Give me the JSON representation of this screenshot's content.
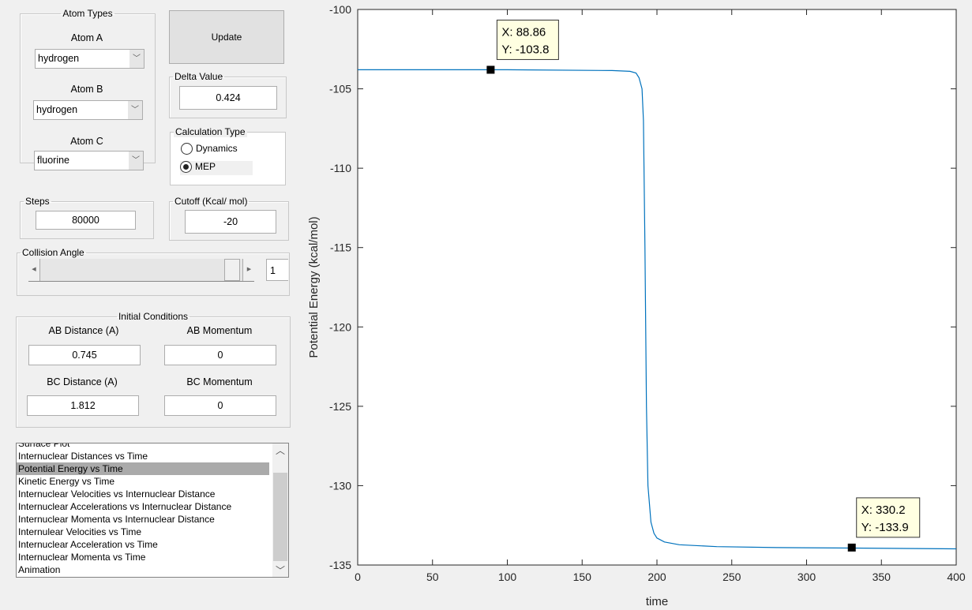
{
  "atom_types": {
    "title": "Atom Types",
    "atom_a_label": "Atom A",
    "atom_a": "hydrogen",
    "atom_b_label": "Atom B",
    "atom_b": "hydrogen",
    "atom_c_label": "Atom C",
    "atom_c": "fluorine"
  },
  "update_label": "Update",
  "delta": {
    "title": "Delta Value",
    "value": "0.424"
  },
  "calc_type": {
    "title": "Calculation Type",
    "options": [
      "Dynamics",
      "MEP"
    ],
    "selected": "MEP"
  },
  "steps": {
    "title": "Steps",
    "value": "80000"
  },
  "cutoff": {
    "title": "Cutoff (Kcal/ mol)",
    "value": "-20"
  },
  "collision": {
    "title": "Collision Angle",
    "value": "1"
  },
  "initial": {
    "title": "Initial Conditions",
    "ab_dist_label": "AB Distance (A)",
    "ab_dist": "0.745",
    "ab_mom_label": "AB Momentum",
    "ab_mom": "0",
    "bc_dist_label": "BC Distance (A)",
    "bc_dist": "1.812",
    "bc_mom_label": "BC Momentum",
    "bc_mom": "0"
  },
  "plot_list": {
    "items": [
      "Surface Plot",
      "Internuclear Distances vs Time",
      "Potential Energy vs Time",
      "Kinetic Energy vs Time",
      "Internuclear Velocities vs Internuclear Distance",
      "Internuclear Accelerations vs Internuclear Distance",
      "Internuclear Momenta vs Internuclear Distance",
      "Internulear Velocities vs Time",
      "Internuclear Acceleration vs Time",
      "Internuclear Momenta vs Time",
      "Animation"
    ],
    "selected_index": 2
  },
  "chart_data": {
    "type": "line",
    "title": "",
    "xlabel": "time",
    "ylabel": "Potential Energy (kcal/mol)",
    "xlim": [
      0,
      400
    ],
    "ylim": [
      -135,
      -100
    ],
    "xticks": [
      0,
      50,
      100,
      150,
      200,
      250,
      300,
      350,
      400
    ],
    "yticks": [
      -100,
      -105,
      -110,
      -115,
      -120,
      -125,
      -130,
      -135
    ],
    "color": "#0072bd",
    "x": [
      0,
      100,
      170,
      182,
      186,
      188,
      190,
      191,
      192,
      193,
      194,
      196,
      198,
      200,
      205,
      215,
      240,
      280,
      330,
      400
    ],
    "y": [
      -103.8,
      -103.8,
      -103.85,
      -103.9,
      -104.0,
      -104.3,
      -105,
      -107,
      -115,
      -125,
      -130,
      -132.3,
      -133.0,
      -133.3,
      -133.55,
      -133.72,
      -133.84,
      -133.9,
      -133.93,
      -133.98
    ],
    "datatips": [
      {
        "x": 88.86,
        "y": -103.8,
        "label_x": "X: 88.86",
        "label_y": "Y: -103.8"
      },
      {
        "x": 330.2,
        "y": -133.9,
        "label_x": "X: 330.2",
        "label_y": "Y: -133.9"
      }
    ]
  }
}
